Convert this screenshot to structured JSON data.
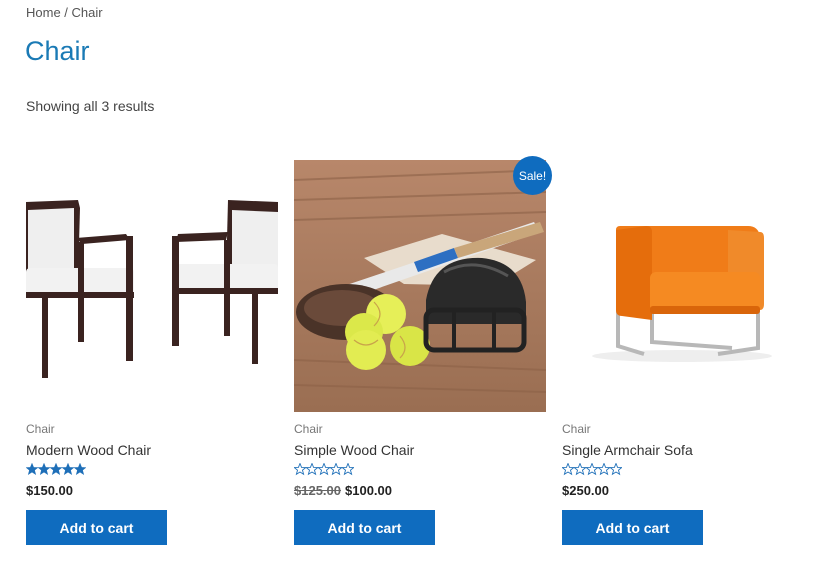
{
  "breadcrumb": {
    "home": "Home",
    "separator": " / ",
    "current": "Chair"
  },
  "page_title": "Chair",
  "result_count": "Showing all 3 results",
  "colors": {
    "accent": "#0f6cbf",
    "title": "#1a7ab5",
    "star": "#1e6fb8"
  },
  "products": [
    {
      "category": "Chair",
      "name": "Modern Wood Chair",
      "rating": 5,
      "price": "$150.00",
      "old_price": "",
      "button": "Add to cart",
      "image": "two-wooden-armchairs-image"
    },
    {
      "category": "Chair",
      "name": "Simple Wood Chair",
      "rating": 0,
      "old_price": "$125.00",
      "price": "$100.00",
      "button": "Add to cart",
      "badge": "Sale!",
      "image": "softball-helmet-bat-image"
    },
    {
      "category": "Chair",
      "name": "Single Armchair Sofa",
      "rating": 0,
      "price": "$250.00",
      "old_price": "",
      "button": "Add to cart",
      "image": "orange-armchair-image"
    }
  ]
}
